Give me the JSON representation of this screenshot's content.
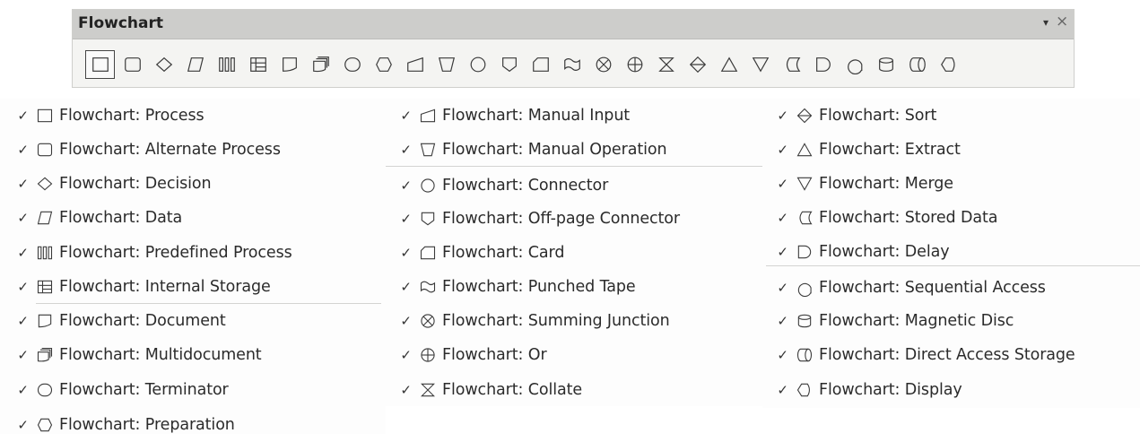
{
  "toolbar": {
    "title": "Flowchart",
    "menu_glyph": "▾",
    "close_glyph": "×",
    "buttons": [
      {
        "icon": "process-icon"
      },
      {
        "icon": "alternate-process-icon"
      },
      {
        "icon": "decision-icon"
      },
      {
        "icon": "data-icon"
      },
      {
        "icon": "predefined-process-icon"
      },
      {
        "icon": "internal-storage-icon"
      },
      {
        "icon": "document-icon"
      },
      {
        "icon": "multidocument-icon"
      },
      {
        "icon": "terminator-icon"
      },
      {
        "icon": "preparation-icon"
      },
      {
        "icon": "manual-input-icon"
      },
      {
        "icon": "manual-operation-icon"
      },
      {
        "icon": "connector-icon"
      },
      {
        "icon": "off-page-connector-icon"
      },
      {
        "icon": "card-icon"
      },
      {
        "icon": "punched-tape-icon"
      },
      {
        "icon": "summing-junction-icon"
      },
      {
        "icon": "or-icon"
      },
      {
        "icon": "collate-icon"
      },
      {
        "icon": "sort-icon"
      },
      {
        "icon": "extract-icon"
      },
      {
        "icon": "merge-icon"
      },
      {
        "icon": "stored-data-icon"
      },
      {
        "icon": "delay-icon"
      },
      {
        "icon": "sequential-access-icon"
      },
      {
        "icon": "magnetic-disc-icon"
      },
      {
        "icon": "direct-access-storage-icon"
      },
      {
        "icon": "display-icon"
      }
    ]
  },
  "check_glyph": "✓",
  "menu_columns": [
    {
      "items": [
        {
          "label": "Flowchart: Process",
          "icon": "process-icon"
        },
        {
          "label": "Flowchart: Alternate Process",
          "icon": "alternate-process-icon"
        },
        {
          "label": "Flowchart: Decision",
          "icon": "decision-icon"
        },
        {
          "label": "Flowchart: Data",
          "icon": "data-icon"
        },
        {
          "label": "Flowchart: Predefined Process",
          "icon": "predefined-process-icon"
        },
        {
          "label": "Flowchart: Internal Storage",
          "icon": "internal-storage-icon"
        },
        {
          "label": "Flowchart: Document",
          "icon": "document-icon"
        },
        {
          "label": "Flowchart: Multidocument",
          "icon": "multidocument-icon"
        },
        {
          "label": "Flowchart: Terminator",
          "icon": "terminator-icon"
        },
        {
          "label": "Flowchart: Preparation",
          "icon": "preparation-icon"
        }
      ]
    },
    {
      "items": [
        {
          "label": "Flowchart: Manual Input",
          "icon": "manual-input-icon"
        },
        {
          "label": "Flowchart: Manual Operation",
          "icon": "manual-operation-icon"
        },
        {
          "label": "Flowchart: Connector",
          "icon": "connector-icon"
        },
        {
          "label": "Flowchart: Off-page Connector",
          "icon": "off-page-connector-icon"
        },
        {
          "label": "Flowchart: Card",
          "icon": "card-icon"
        },
        {
          "label": "Flowchart: Punched Tape",
          "icon": "punched-tape-icon"
        },
        {
          "label": "Flowchart: Summing Junction",
          "icon": "summing-junction-icon"
        },
        {
          "label": "Flowchart: Or",
          "icon": "or-icon"
        },
        {
          "label": "Flowchart: Collate",
          "icon": "collate-icon"
        }
      ]
    },
    {
      "items": [
        {
          "label": "Flowchart: Sort",
          "icon": "sort-icon"
        },
        {
          "label": "Flowchart: Extract",
          "icon": "extract-icon"
        },
        {
          "label": "Flowchart: Merge",
          "icon": "merge-icon"
        },
        {
          "label": "Flowchart: Stored Data",
          "icon": "stored-data-icon"
        },
        {
          "label": "Flowchart: Delay",
          "icon": "delay-icon"
        },
        {
          "label": "Flowchart: Sequential Access",
          "icon": "sequential-access-icon"
        },
        {
          "label": "Flowchart: Magnetic Disc",
          "icon": "magnetic-disc-icon"
        },
        {
          "label": "Flowchart: Direct Access Storage",
          "icon": "direct-access-storage-icon"
        },
        {
          "label": "Flowchart: Display",
          "icon": "display-icon"
        }
      ]
    }
  ]
}
